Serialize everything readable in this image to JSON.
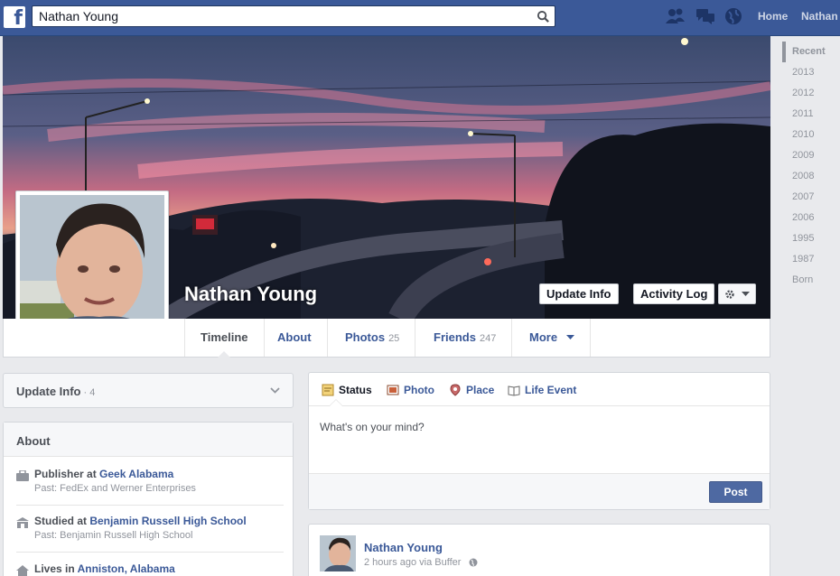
{
  "header": {
    "search_value": "Nathan Young",
    "nav_home": "Home",
    "nav_user": "Nathan"
  },
  "profile": {
    "name": "Nathan Young",
    "update_info_button": "Update Info",
    "activity_log_button": "Activity Log"
  },
  "tabs": [
    {
      "label": "Timeline",
      "count": ""
    },
    {
      "label": "About",
      "count": ""
    },
    {
      "label": "Photos",
      "count": "25"
    },
    {
      "label": "Friends",
      "count": "247"
    },
    {
      "label": "More",
      "count": ""
    }
  ],
  "timeline_years": [
    "Recent",
    "2013",
    "2012",
    "2011",
    "2010",
    "2009",
    "2008",
    "2007",
    "2006",
    "1995",
    "1987",
    "Born"
  ],
  "update_info_card": {
    "title": "Update Info",
    "count": "4"
  },
  "about": {
    "title": "About",
    "items": [
      {
        "prefix": "Publisher at ",
        "link": "Geek Alabama",
        "sub": "Past: FedEx and Werner Enterprises"
      },
      {
        "prefix": "Studied at ",
        "link": "Benjamin Russell High School",
        "sub": "Past: Benjamin Russell High School"
      },
      {
        "prefix": "Lives in ",
        "link": "Anniston, Alabama",
        "sub": ""
      }
    ]
  },
  "composer": {
    "tabs": [
      "Status",
      "Photo",
      "Place",
      "Life Event"
    ],
    "placeholder": "What's on your mind?",
    "post_button": "Post"
  },
  "story": {
    "author": "Nathan Young",
    "meta": "2 hours ago via Buffer"
  },
  "colors": {
    "brand": "#3b5998",
    "link": "#3b5998",
    "post_button": "#4e69a2"
  }
}
